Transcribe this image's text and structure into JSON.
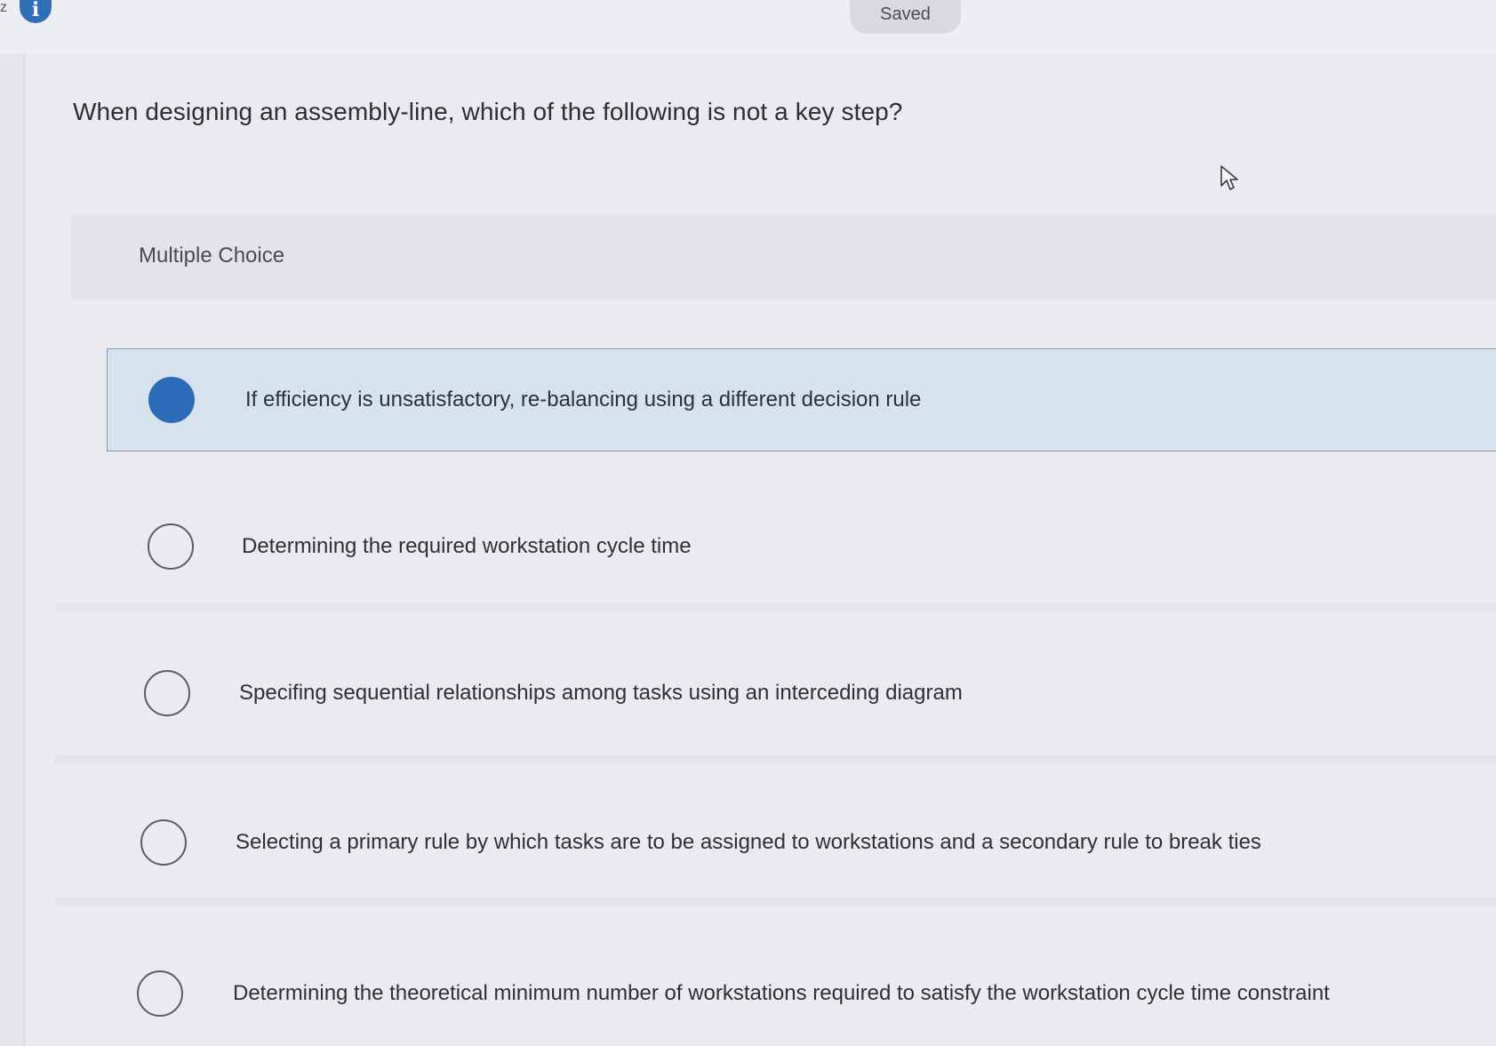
{
  "top": {
    "saved_label": "Saved",
    "edge_text": "z"
  },
  "question": {
    "text": "When designing an assembly-line, which of the following is not a key step?"
  },
  "multiple_choice": {
    "header_label": "Multiple Choice",
    "options": [
      {
        "label": "If efficiency is unsatisfactory, re-balancing using a different decision rule",
        "selected": true
      },
      {
        "label": "Determining the required workstation cycle time",
        "selected": false
      },
      {
        "label": "Specifing sequential relationships among tasks using an interceding diagram",
        "selected": false
      },
      {
        "label": "Selecting a primary rule by which tasks are to be assigned to workstations and a secondary rule to break ties",
        "selected": false
      },
      {
        "label": "Determining the theoretical minimum number of workstations required to satisfy the workstation cycle time constraint",
        "selected": false
      }
    ]
  },
  "colors": {
    "accent": "#2b6bb8",
    "selected_bg": "#d6e3ee",
    "page_bg": "#e9ebee"
  },
  "icons": {
    "info": "info-icon",
    "cursor": "pointer-cursor-icon",
    "radio": "radio-icon"
  }
}
